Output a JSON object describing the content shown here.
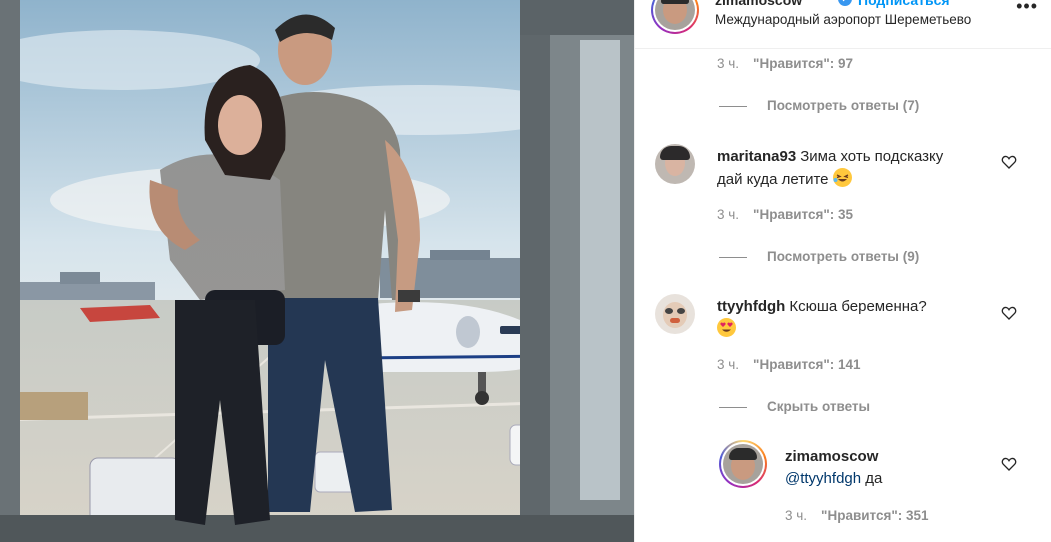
{
  "post": {
    "username": "zimamoscow",
    "follow_label": "Подписаться",
    "location": "Международный аэропорт Шереметьево",
    "more_label": "•••"
  },
  "thread": {
    "top_meta": {
      "time": "3 ч.",
      "likes": "\"Нравится\": 97"
    },
    "top_replies": "Посмотреть ответы (7)",
    "comments": [
      {
        "username": "maritana93",
        "text_line1": "Зима хоть подсказку",
        "text_line2": "дай куда летите",
        "emoji": "rolling-on-floor-laughing",
        "time": "3 ч.",
        "likes": "\"Нравится\": 35",
        "replies": "Посмотреть ответы (9)"
      },
      {
        "username": "ttyyhfdgh",
        "text_line1": "Ксюша беременна?",
        "emoji": "heart-eyes",
        "time": "3 ч.",
        "likes": "\"Нравится\": 141",
        "replies": "Скрыть ответы"
      }
    ],
    "reply": {
      "username": "zimamoscow",
      "mention": "@ttyyhfdgh",
      "text": "да",
      "time": "3 ч.",
      "likes": "\"Нравится\": 351"
    }
  },
  "colors": {
    "link": "#0095f6",
    "muted": "#8e8e8e",
    "text": "#262626",
    "mention": "#00376b"
  },
  "icons": [
    "verified-badge-icon",
    "more-options-icon",
    "heart-icon"
  ]
}
